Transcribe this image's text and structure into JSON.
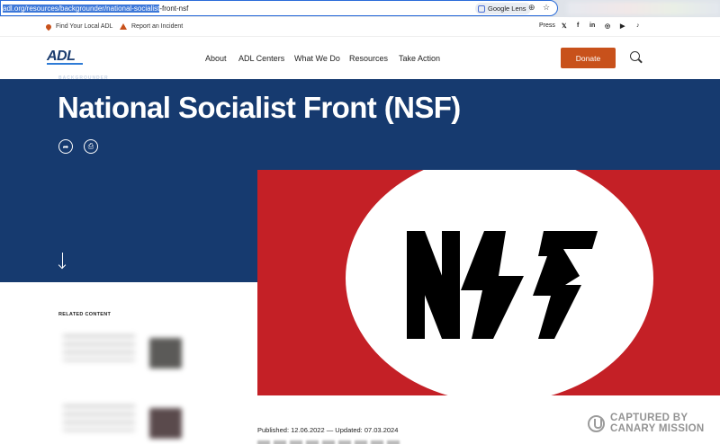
{
  "browser": {
    "url_selected": "adl.org/resources/backgrounder/national-socialist",
    "url_rest": "-front-nsf",
    "lens_label": "Google Lens"
  },
  "utility": {
    "find_local": "Find Your Local ADL",
    "report": "Report an Incident",
    "press": "Press",
    "social": [
      "𝕏",
      "f",
      "in",
      "◎",
      "▶",
      "♪"
    ]
  },
  "nav": {
    "logo": "ADL",
    "links": [
      "About",
      "ADL Centers",
      "What We Do",
      "Resources",
      "Take Action"
    ],
    "donate": "Donate"
  },
  "hero": {
    "eyebrow": "BACKGROUNDER",
    "title": "National Socialist Front (NSF)"
  },
  "image": {
    "flag_text": "NSF",
    "colors": {
      "field": "#c42026",
      "disc": "#ffffff",
      "letters": "#000000"
    }
  },
  "related": {
    "heading": "RELATED CONTENT"
  },
  "meta": {
    "published": "Published: 12.06.2022 — Updated: 07.03.2024"
  },
  "watermark": {
    "line1": "CAPTURED BY",
    "line2": "CANARY MISSION"
  },
  "colors": {
    "hero": "#163a6f",
    "accent": "#c8511b"
  }
}
